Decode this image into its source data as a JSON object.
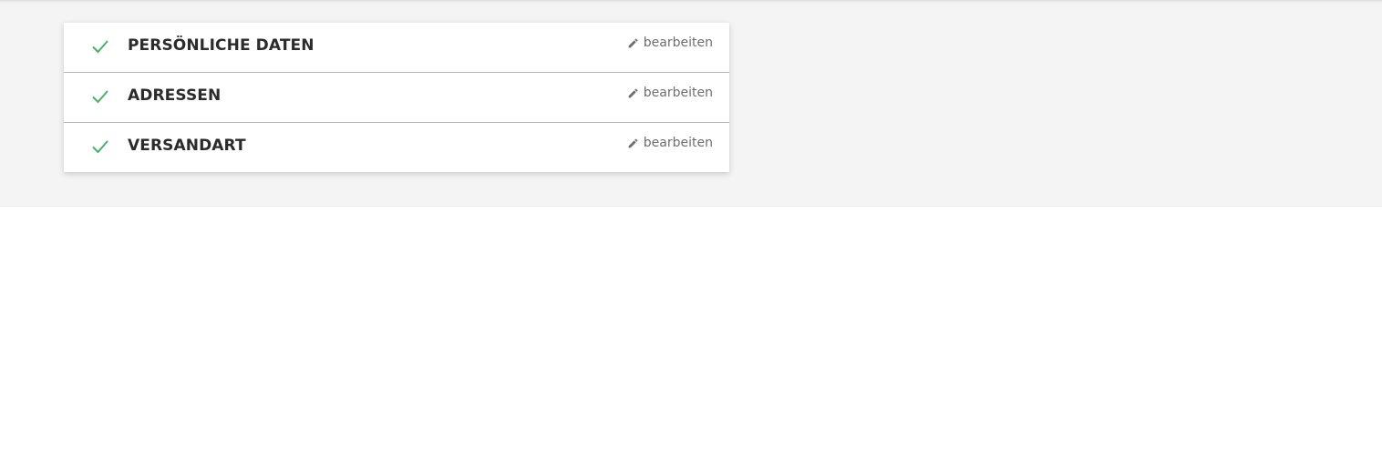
{
  "checkout_steps": [
    {
      "title": "PERSÖNLICHE DATEN",
      "edit_label": "bearbeiten",
      "status": "completed"
    },
    {
      "title": "ADRESSEN",
      "edit_label": "bearbeiten",
      "status": "completed"
    },
    {
      "title": "VERSANDART",
      "edit_label": "bearbeiten",
      "status": "completed"
    }
  ],
  "colors": {
    "check": "#4caf6a",
    "band_background": "#f4f4f5",
    "title": "#2b2b2b",
    "edit_text": "#6e6e6e"
  },
  "icons": {
    "status": "check-icon",
    "edit": "pencil-icon"
  }
}
